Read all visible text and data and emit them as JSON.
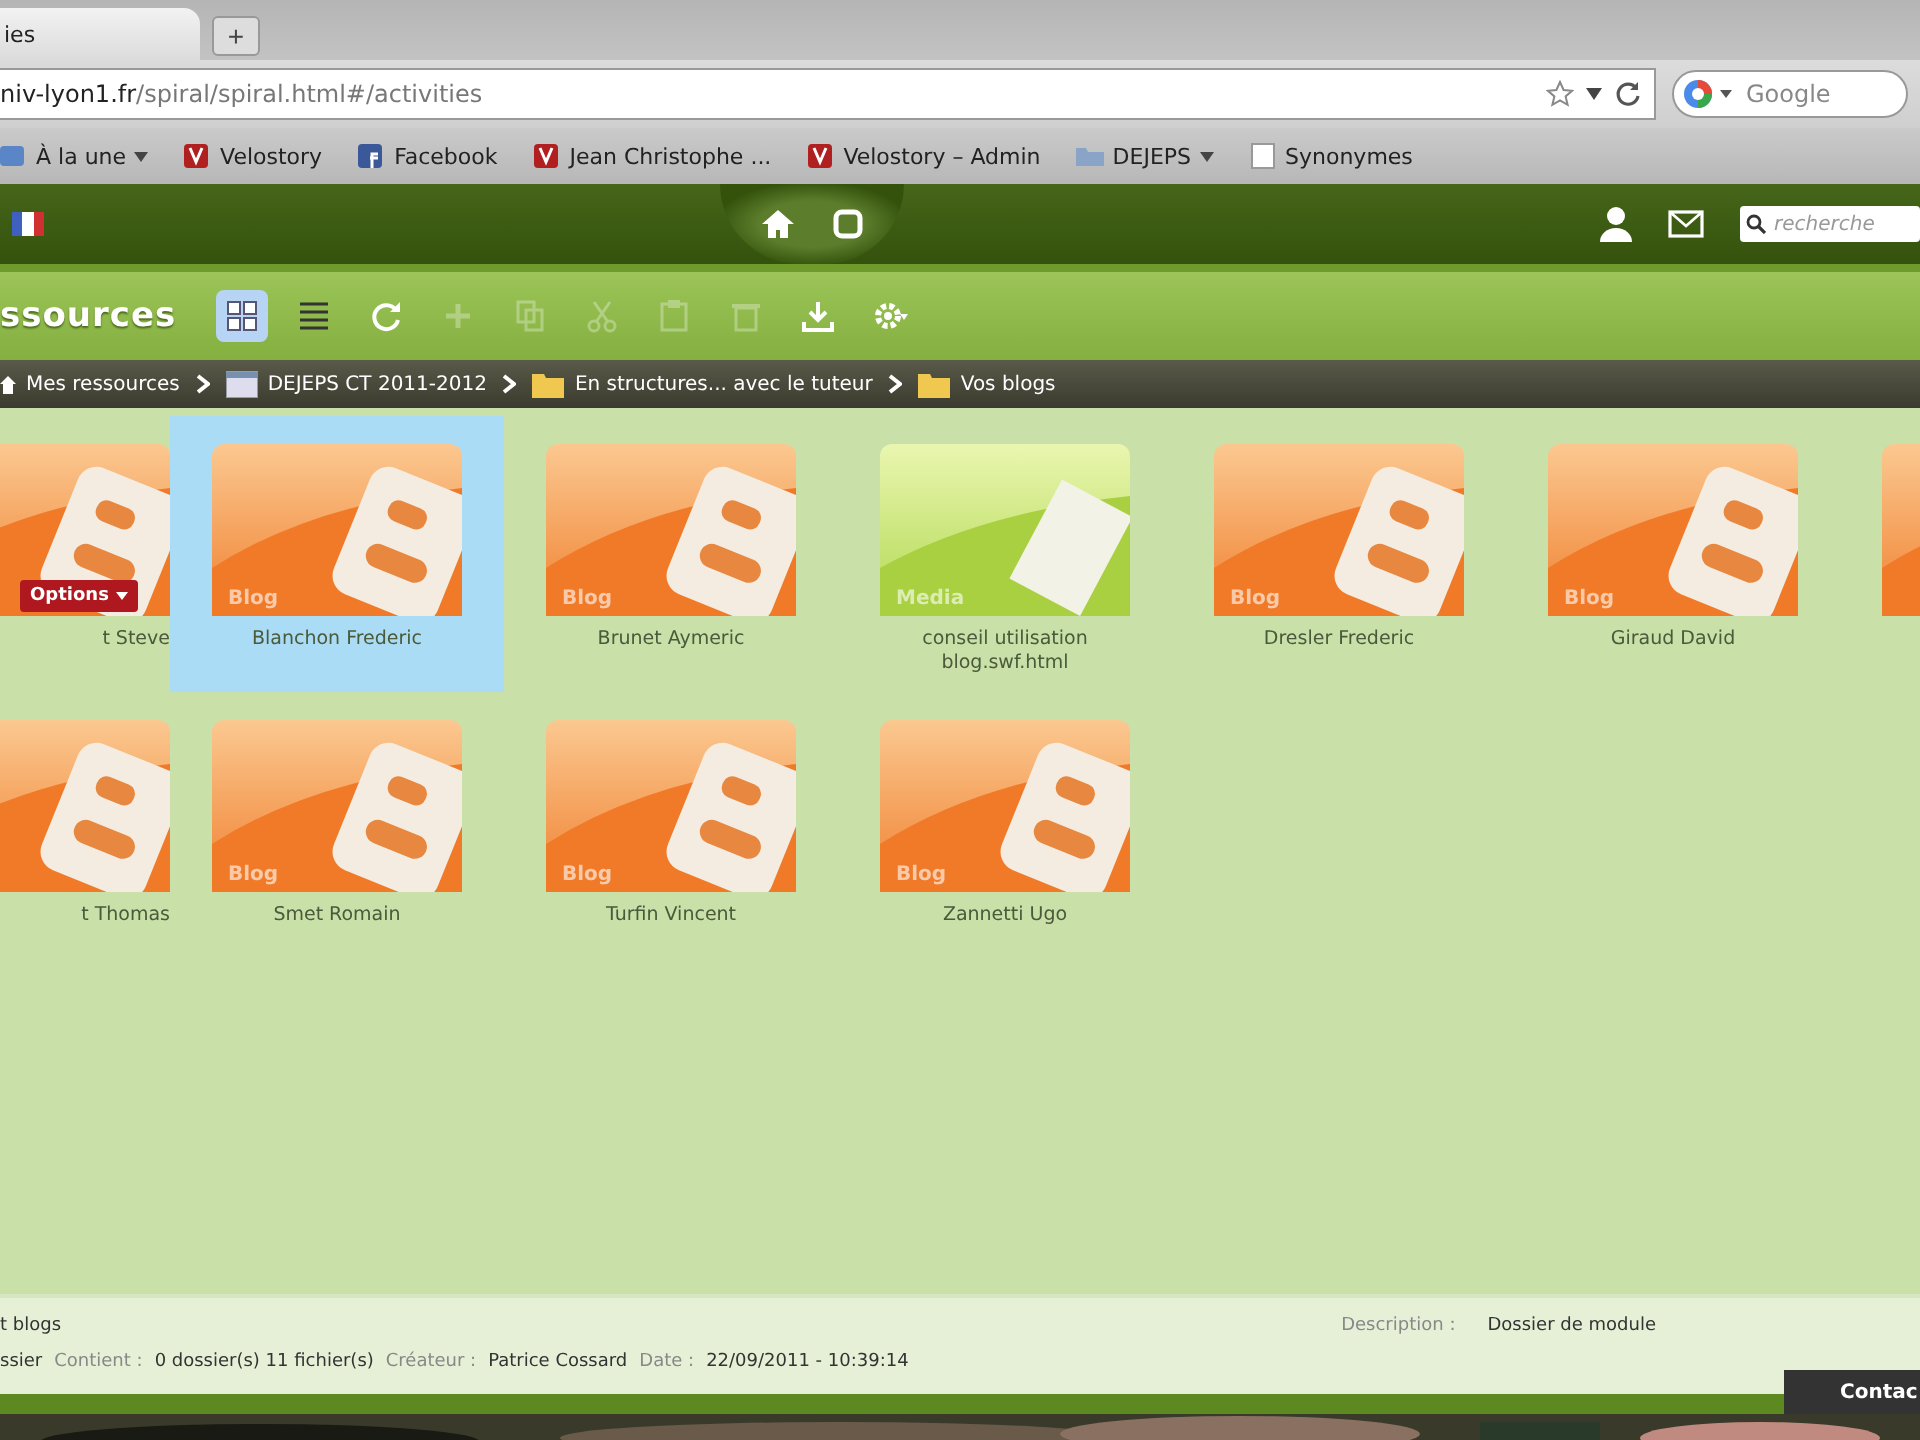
{
  "browser": {
    "tabs": [
      {
        "label": "ies",
        "selected": true
      }
    ],
    "new_tab": "+",
    "url": {
      "host": "niv-lyon1.fr",
      "path": "/spiral/spiral.html#/activities"
    },
    "search": {
      "placeholder": "Google"
    },
    "bookmarks": [
      {
        "label": "À la une",
        "kind": "feed",
        "menu": true
      },
      {
        "label": "Velostory",
        "kind": "site",
        "menu": false
      },
      {
        "label": "Facebook",
        "kind": "social",
        "menu": false
      },
      {
        "label": "Jean Christophe ...",
        "kind": "site",
        "menu": false
      },
      {
        "label": "Velostory – Admin",
        "kind": "site",
        "menu": false
      },
      {
        "label": "DEJEPS",
        "kind": "folder",
        "menu": true
      },
      {
        "label": "Synonymes",
        "kind": "page",
        "menu": false
      }
    ]
  },
  "header": {
    "search": {
      "placeholder": "recherche"
    }
  },
  "title": "ssources",
  "toolbar": [
    {
      "kind": "grid",
      "selected": true,
      "disabled": false
    },
    {
      "kind": "list",
      "selected": false,
      "disabled": false
    },
    {
      "kind": "refresh",
      "selected": false,
      "disabled": false
    },
    {
      "kind": "add",
      "selected": false,
      "disabled": true
    },
    {
      "kind": "copy",
      "selected": false,
      "disabled": true
    },
    {
      "kind": "cut",
      "selected": false,
      "disabled": true
    },
    {
      "kind": "paste",
      "selected": false,
      "disabled": true
    },
    {
      "kind": "delete",
      "selected": false,
      "disabled": true
    },
    {
      "kind": "download",
      "selected": false,
      "disabled": false
    },
    {
      "kind": "settings",
      "selected": false,
      "disabled": false
    }
  ],
  "breadcrumb": [
    {
      "label": "Mes ressources",
      "kind": "home"
    },
    {
      "label": "DEJEPS CT 2011-2012",
      "kind": "module"
    },
    {
      "label": "En structures... avec le tuteur",
      "kind": "folder"
    },
    {
      "label": "Vos blogs",
      "kind": "folder"
    }
  ],
  "rows": [
    [
      {
        "kind": "blog",
        "label": "t Steve",
        "selected": false,
        "options": "Options"
      },
      {
        "kind": "blog",
        "label": "Blanchon Frederic",
        "badge": "Blog",
        "selected": true
      },
      {
        "kind": "blog",
        "label": "Brunet Aymeric",
        "badge": "Blog",
        "selected": false
      },
      {
        "kind": "media",
        "label": "conseil utilisation blog.swf.html",
        "badge": "Media",
        "selected": false
      },
      {
        "kind": "blog",
        "label": "Dresler Frederic",
        "badge": "Blog",
        "selected": false
      },
      {
        "kind": "blog",
        "label": "Giraud David",
        "badge": "Blog",
        "selected": false
      },
      {
        "kind": "blog",
        "selected": false
      }
    ],
    [
      {
        "kind": "blog",
        "label": "t Thomas",
        "selected": false
      },
      {
        "kind": "blog",
        "label": "Smet Romain",
        "badge": "Blog",
        "selected": false
      },
      {
        "kind": "blog",
        "label": "Turfin Vincent",
        "badge": "Blog",
        "selected": false
      },
      {
        "kind": "blog",
        "label": "Zannetti Ugo",
        "badge": "Blog",
        "selected": false
      }
    ]
  ],
  "footer": {
    "name": "t blogs",
    "description_label": "Description :",
    "description": "Dossier de module",
    "details": [
      {
        "label": "ssier",
        "kind": "value"
      },
      {
        "label": "Contient :",
        "kind": "key"
      },
      {
        "label": "0 dossier(s) 11 fichier(s)",
        "kind": "value"
      },
      {
        "label": "Créateur :",
        "kind": "key"
      },
      {
        "label": "Patrice Cossard",
        "kind": "value"
      },
      {
        "label": "Date :",
        "kind": "key"
      },
      {
        "label": "22/09/2011 - 10:39:14",
        "kind": "value"
      }
    ]
  },
  "contact": "Contac"
}
